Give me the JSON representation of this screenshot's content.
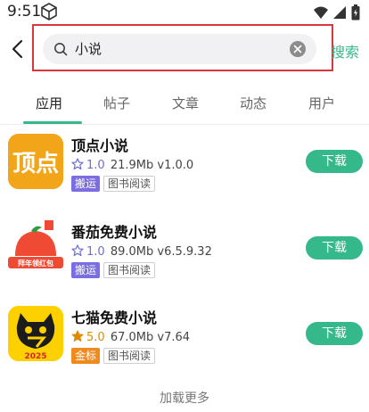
{
  "status_bar": {
    "time": "9:51"
  },
  "search": {
    "query": "小说",
    "action_label": "搜索"
  },
  "tabs": [
    {
      "label": "应用",
      "active": true
    },
    {
      "label": "帖子",
      "active": false
    },
    {
      "label": "文章",
      "active": false
    },
    {
      "label": "动态",
      "active": false
    },
    {
      "label": "用户",
      "active": false
    }
  ],
  "apps": [
    {
      "name": "顶点小说",
      "rating": "1.0",
      "size": "21.9Mb",
      "version": "v1.0.0",
      "primary_tag": "搬运",
      "category_tag": "图书阅读",
      "download_label": "下载",
      "icon_text": "顶点"
    },
    {
      "name": "番茄免费小说",
      "rating": "1.0",
      "size": "89.0Mb",
      "version": "v6.5.9.32",
      "primary_tag": "搬运",
      "category_tag": "图书阅读",
      "download_label": "下载",
      "icon_text": "拜年领红包"
    },
    {
      "name": "七猫免费小说",
      "rating": "5.0",
      "size": "67.0Mb",
      "version": "v7.64",
      "primary_tag": "金标",
      "category_tag": "图书阅读",
      "download_label": "下载",
      "icon_text": "2025"
    }
  ],
  "load_more_label": "加载更多",
  "colors": {
    "accent": "#35b88a",
    "tag_purple": "#7a6ee0",
    "tag_orange": "#f08a1d",
    "highlight_red": "#d9363e"
  }
}
